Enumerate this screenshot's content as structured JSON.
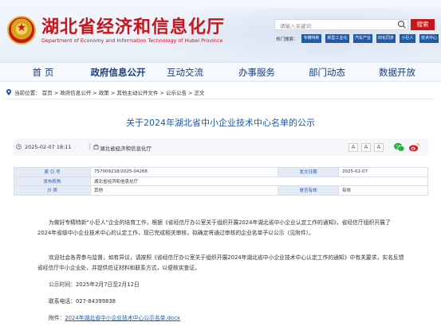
{
  "header": {
    "title": "湖北省经济和信息化厅",
    "subtitle": "Department of Economy and Information Technology of Hubei Province",
    "search_placeholder": "请输入关键词",
    "search_button": "搜索",
    "hot_label": "热门搜索：",
    "hot_tags": [
      "专精特新",
      "新型工业化",
      "汽车产业",
      "四化同步",
      "小巨人",
      "技术中心"
    ]
  },
  "nav": {
    "items": [
      "首 页",
      "政府信息公开",
      "互动交流",
      "办事服务",
      "部门动态",
      "数据开放"
    ]
  },
  "breadcrumb": {
    "label": "当前位置：",
    "path": "首页 > 政府信息公开 > 政策 > 其他主动公开文件 > 公示公告 > 正文"
  },
  "article": {
    "title": "关于2024年湖北省中小企业技术中心名单的公示",
    "date": "2025-02-07 18:11",
    "separator": "|",
    "source": "湖北省经济和信息化厅",
    "font_sizes": [
      "A",
      "A",
      "A"
    ],
    "share_icons": [
      "wechat-icon",
      "weibo-icon"
    ]
  },
  "info_table": {
    "index_label": "索 引 号",
    "index_value": "757009218/2025-04268",
    "date_label": "发文日期",
    "date_value": "2025-02-07",
    "publisher_label": "发布机构",
    "publisher_value": "湖北省经济和信息化厅",
    "category_label": "分 类",
    "category_value": "其他",
    "validity_label": "是否有效",
    "validity_value": "有效"
  },
  "body": {
    "para1": "为做好专精特新“小巨人”企业的培育工作，根据《省经信厅办公室关于组织开展2024年湖北省中小企业认定工作的通知》，省经信厅组织开展了2024年省级中小企业技术中心的认定工作，现已完成相关审核，拟确定将通过审核的企业名单予以公示（见附件）。",
    "para2": "欢迎社会各界参与监督，如有异议，请按照《省经信厅办公室关于组织开展2024年湖北省中小企业技术中心认定工作的通知》中有关要求，实名反馈省经信厅中小企业处，并提供佐证材料和联系方式，以便核实查证。",
    "period": "公示时间：2025年2月7日至2月12日",
    "phone": "联系电话：027-84399838",
    "attachment_label": "附件：",
    "attachment_name": "2024年湖北省中小企业技术中心公示名单.docx"
  },
  "colors": {
    "brand_red": "#c4161c",
    "link_blue": "#1f5aa8",
    "nav_text": "#1d3f7a"
  }
}
